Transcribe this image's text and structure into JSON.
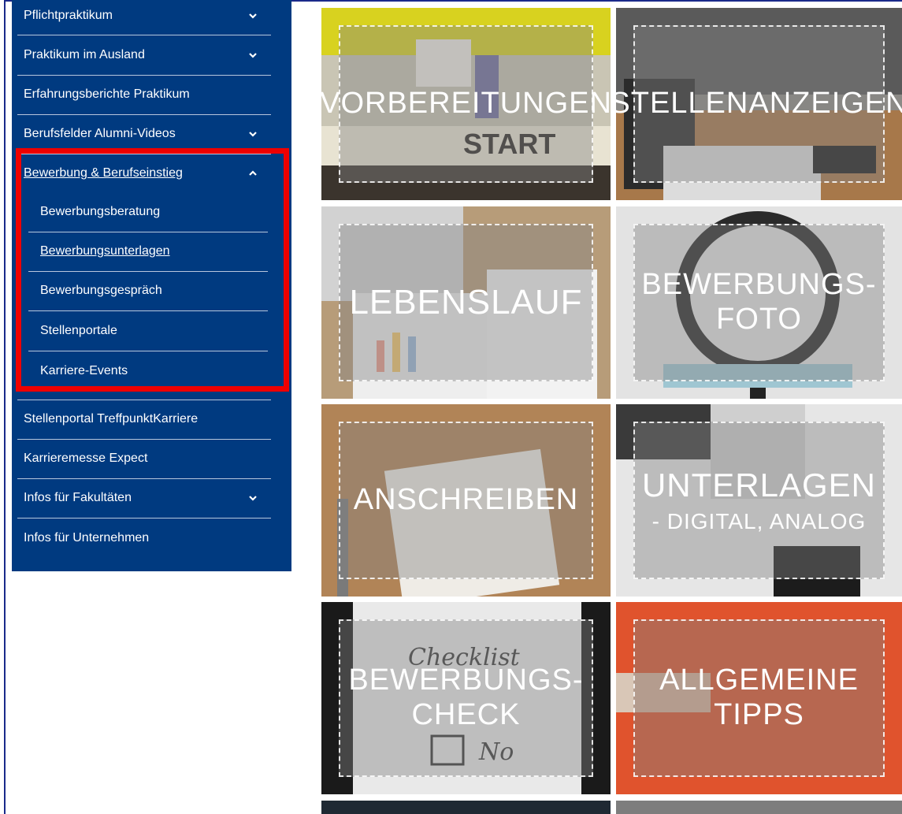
{
  "sidebar": {
    "items": [
      {
        "label": "Pflichtpraktikum",
        "chevron": "chevron-down"
      },
      {
        "label": "Praktikum im Ausland",
        "chevron": "chevron-down"
      },
      {
        "label": "Erfahrungsberichte Praktikum",
        "chevron": ""
      },
      {
        "label": "Berufsfelder Alumni-Videos",
        "chevron": "chevron-down"
      },
      {
        "label": "Bewerbung & Berufseinstieg",
        "chevron": "chevron-up"
      },
      {
        "label": "Stellenportal TreffpunktKarriere",
        "chevron": ""
      },
      {
        "label": "Karrieremesse Expect",
        "chevron": ""
      },
      {
        "label": "Infos für Fakultäten",
        "chevron": "chevron-down"
      },
      {
        "label": "Infos für Unternehmen",
        "chevron": ""
      }
    ],
    "subitems": [
      {
        "label": "Bewerbungsberatung"
      },
      {
        "label": "Bewerbungsunterlagen"
      },
      {
        "label": "Bewerbungsgespräch"
      },
      {
        "label": "Stellenportale"
      },
      {
        "label": "Karriere-Events"
      }
    ]
  },
  "tiles": [
    {
      "line1": "VORBEREITUNGEN",
      "line2": "",
      "image": "start-board-game"
    },
    {
      "line1": "STELLENANZEIGEN",
      "line2": "",
      "image": "laptop-desk"
    },
    {
      "line1": "LEBENSLAUF",
      "line2": "",
      "image": "charts-on-desk"
    },
    {
      "line1": "BEWERBUNGS-",
      "line2": "FOTO",
      "image": "ring-light"
    },
    {
      "line1": "ANSCHREIBEN",
      "line2": "",
      "image": "notepad-pen"
    },
    {
      "line1": "UNTERLAGEN",
      "line2": "- DIGITAL, ANALOG",
      "image": "keyboard-phone"
    },
    {
      "line1": "BEWERBUNGS-",
      "line2": "CHECK",
      "image": "checklist-notebook"
    },
    {
      "line1": "ALLGEMEINE",
      "line2": "TIPPS",
      "image": "thumbs-up"
    }
  ],
  "colors": {
    "sidebar_bg": "#003a80",
    "highlight": "#ee0000"
  }
}
